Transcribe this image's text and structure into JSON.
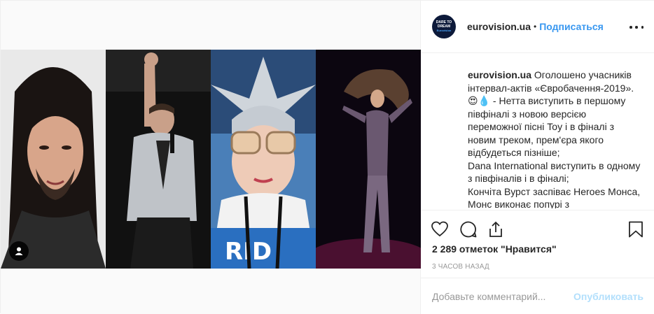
{
  "post": {
    "username": "eurovision.ua",
    "separator": "•",
    "follow_label": "Подписаться",
    "avatar_text_line1": "DARE TO",
    "avatar_text_line2": "DREAM",
    "avatar_text_line3": "Eurovision"
  },
  "caption": {
    "user": "eurovision.ua",
    "lines": [
      "Оголошено учасників інтервал-актів «Євробачення-2019».",
      "😍💧 - Нетта виступить в першому півфіналі з новою версією переможної пісні Toy і в фіналі з новим треком, прем'єра якого відбудеться пізніше;",
      "Dana International виступить в одному з півфіналів і в фіналі;",
      "Кончіта Вурст заспіває Heroes Монса, Монс виконає попурі з"
    ]
  },
  "actions": {
    "like_icon": "heart-icon",
    "comment_icon": "comment-icon",
    "share_icon": "share-icon",
    "save_icon": "bookmark-icon"
  },
  "likes_text": "2 289 отметок \"Нравится\"",
  "timestamp": "3 часов назад",
  "comment": {
    "placeholder": "Добавьте комментарий...",
    "publish_label": "Опубликовать"
  },
  "colors": {
    "accent": "#3897f0",
    "publish_disabled": "#b2dffc",
    "border": "#efefef",
    "muted_text": "#999999"
  }
}
